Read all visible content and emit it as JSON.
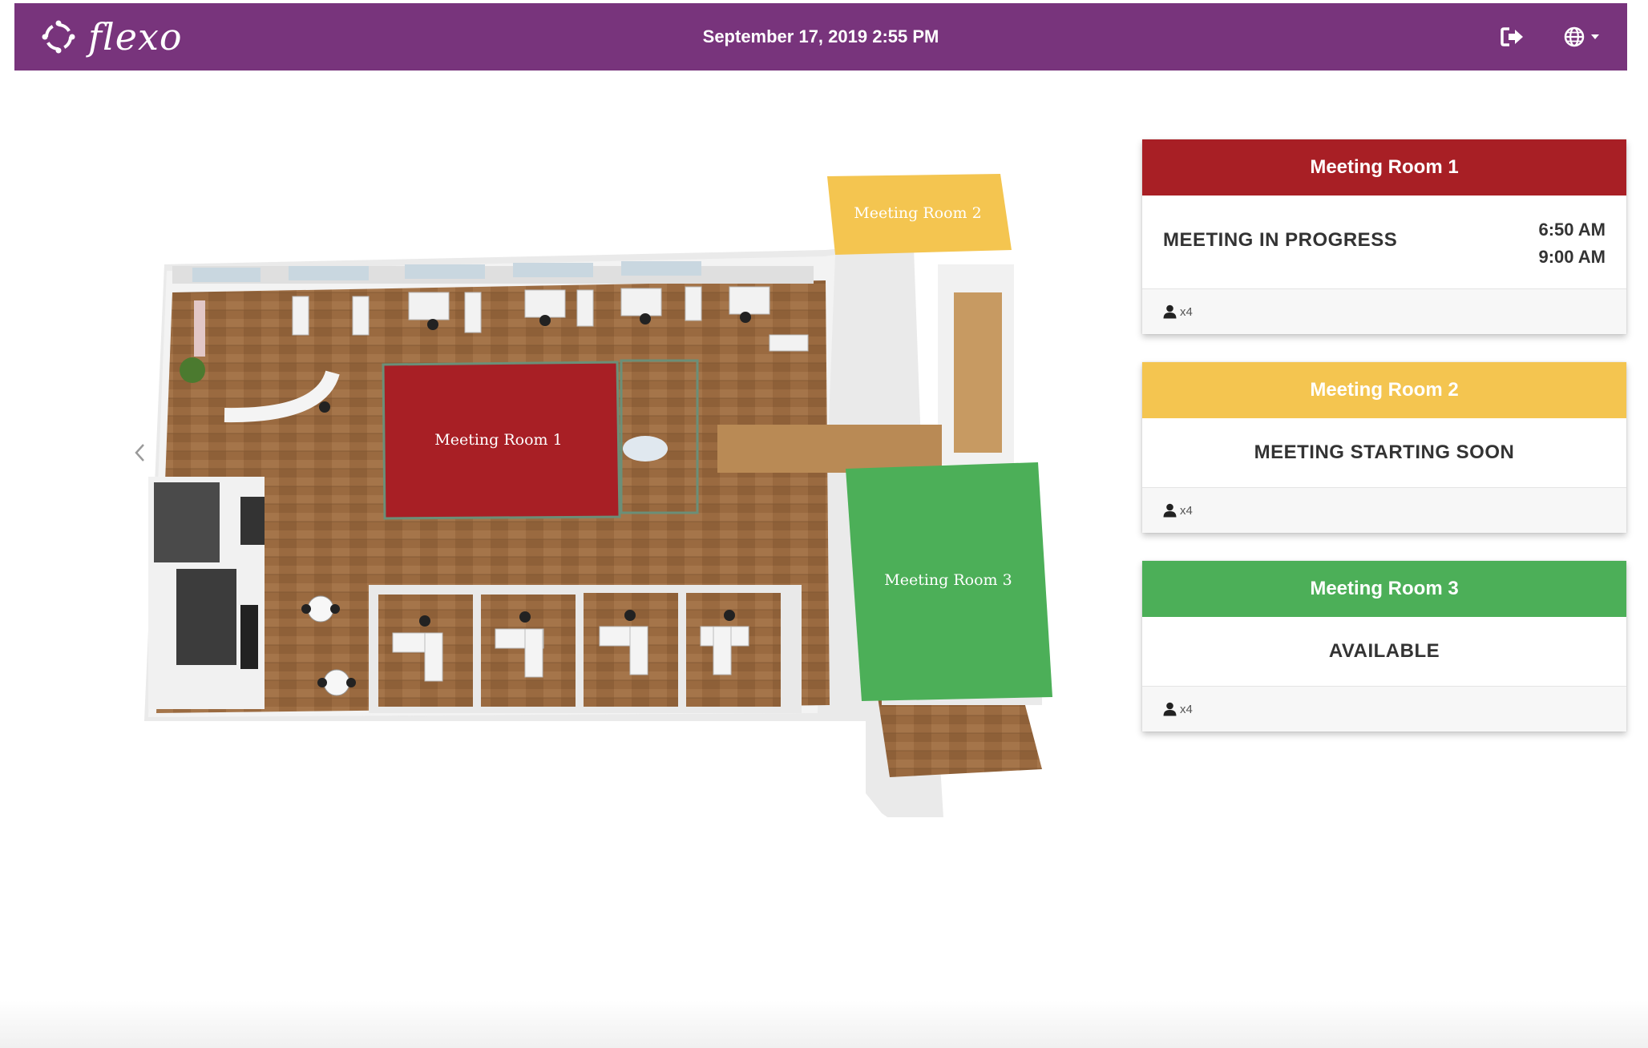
{
  "app": {
    "logo_text": "flexo",
    "datetime": "September 17, 2019 2:55 PM"
  },
  "colors": {
    "navbar": "#78347c",
    "busy": "#a81f25",
    "soon": "#f4c550",
    "available": "#4caf58"
  },
  "icons": {
    "logo": "flexo-logo-icon",
    "logout": "logout-icon",
    "language": "globe-icon",
    "capacity": "user-icon",
    "prev": "chevron-left-icon"
  },
  "floorplan": {
    "rooms": [
      {
        "label": "Meeting Room 1",
        "status": "busy"
      },
      {
        "label": "Meeting Room 2",
        "status": "soon"
      },
      {
        "label": "Meeting Room 3",
        "status": "available"
      }
    ]
  },
  "cards": [
    {
      "title": "Meeting Room 1",
      "status": "MEETING IN PROGRESS",
      "start_time": "6:50 AM",
      "end_time": "9:00 AM",
      "capacity": "x4"
    },
    {
      "title": "Meeting Room 2",
      "status": "MEETING STARTING SOON",
      "capacity": "x4"
    },
    {
      "title": "Meeting Room 3",
      "status": "AVAILABLE",
      "capacity": "x4"
    }
  ]
}
